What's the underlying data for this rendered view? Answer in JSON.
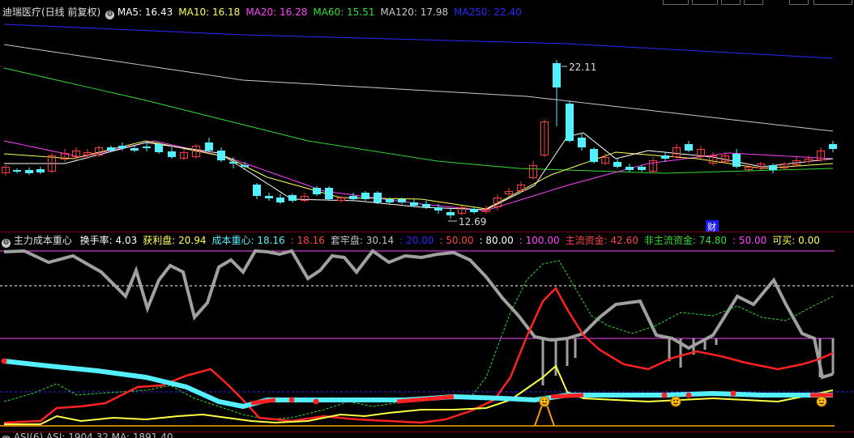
{
  "colors": {
    "up": "#ff3b3b",
    "down": "#55f0ff",
    "ma5": "#ffffff",
    "ma10": "#ffff55",
    "ma20": "#ff44ff",
    "ma60": "#33dd33",
    "ma120": "#c8c8c8",
    "ma250": "#2a2aff"
  },
  "main_panel": {
    "title": "迪瑞医疗(日线 前复权)",
    "ma": [
      {
        "label": "MA5: 16.43",
        "color": "#ffffff"
      },
      {
        "label": "MA10: 16.18",
        "color": "#ffff55"
      },
      {
        "label": "MA20: 16.28",
        "color": "#ff44ff"
      },
      {
        "label": "MA60: 15.51",
        "color": "#33dd33"
      },
      {
        "label": "MA120: 17.98",
        "color": "#c8c8c8"
      },
      {
        "label": "MA250: 22.40",
        "color": "#2a2aff"
      }
    ],
    "high_label": "22.11",
    "low_label": "12.69",
    "fin_badge": "财"
  },
  "indicator_panel": {
    "title": "主力成本重心",
    "items": [
      {
        "label": "换手率: 4.03",
        "color": "#ffffff"
      },
      {
        "label": "获利盘: 20.94",
        "color": "#ffff55"
      },
      {
        "label": "成本重心: 18.16",
        "color": "#55f0ff"
      },
      {
        "label": ": 18.16",
        "color": "#ff4444"
      },
      {
        "label": "套牢盘: 30.14",
        "color": "#c0c0c0"
      },
      {
        "label": ": 20.00",
        "color": "#2a2aff"
      },
      {
        "label": ": 50.00",
        "color": "#ff4444"
      },
      {
        "label": ": 80.00",
        "color": "#ffffff"
      },
      {
        "label": ": 100.00",
        "color": "#ff44ff"
      },
      {
        "label": "主流资金: 42.60",
        "color": "#ff4444"
      },
      {
        "label": "非主流资金: 74.80",
        "color": "#33dd33"
      },
      {
        "label": ": 50.00",
        "color": "#ff44ff"
      },
      {
        "label": "可买: 0.00",
        "color": "#ffff55"
      }
    ]
  },
  "bottom_panel": {
    "label": "ASI(6) ASI: 1904.32 MA: 1891.40"
  }
}
